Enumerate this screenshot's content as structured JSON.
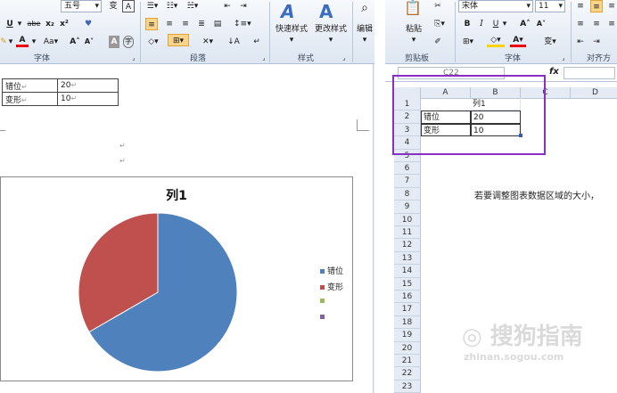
{
  "word": {
    "ribbon": {
      "font_size_value": "五号",
      "group_labels": {
        "font": "字体",
        "paragraph": "段落",
        "styles": "样式",
        "edit": "编辑"
      },
      "quick_styles": "快速样式",
      "change_styles": "更改样式",
      "edit_label": "编辑"
    },
    "table": {
      "rows": [
        {
          "label": "错位",
          "value": "20"
        },
        {
          "label": "变形",
          "value": "10"
        }
      ],
      "para_mark": "↵"
    },
    "chart": {
      "title": "列1",
      "legend": [
        {
          "label": "错位",
          "color": "#4f81bd"
        },
        {
          "label": "变形",
          "color": "#c0504d"
        },
        {
          "label": "",
          "color": "#9bbb59"
        },
        {
          "label": "",
          "color": "#8064a2"
        }
      ]
    }
  },
  "chart_data": {
    "type": "pie",
    "title": "列1",
    "categories": [
      "错位",
      "变形"
    ],
    "values": [
      20,
      10
    ],
    "colors": [
      "#4f81bd",
      "#c0504d"
    ],
    "legend_position": "right"
  },
  "excel": {
    "ribbon": {
      "paste": "粘贴",
      "clipboard": "剪贴板",
      "font_name": "宋体",
      "font_size": "11",
      "font_group": "字体",
      "align_group": "对齐方式"
    },
    "formula_bar": {
      "name_box": "C22",
      "fx": "fx"
    },
    "columns": [
      "A",
      "B",
      "C",
      "D"
    ],
    "rows": [
      "1",
      "2",
      "3",
      "4",
      "5",
      "6",
      "7",
      "8",
      "9",
      "10",
      "11",
      "12",
      "13",
      "14",
      "15",
      "16",
      "17",
      "18",
      "19",
      "20",
      "21",
      "22",
      "23"
    ],
    "cells": {
      "B1": "列1",
      "A2": "错位",
      "B2": "20",
      "A3": "变形",
      "B3": "10",
      "B8": "若要调整图表数据区域的大小，"
    },
    "watermark": {
      "line1": "搜狗指南",
      "line2": "zhinan.sogou.com"
    }
  }
}
